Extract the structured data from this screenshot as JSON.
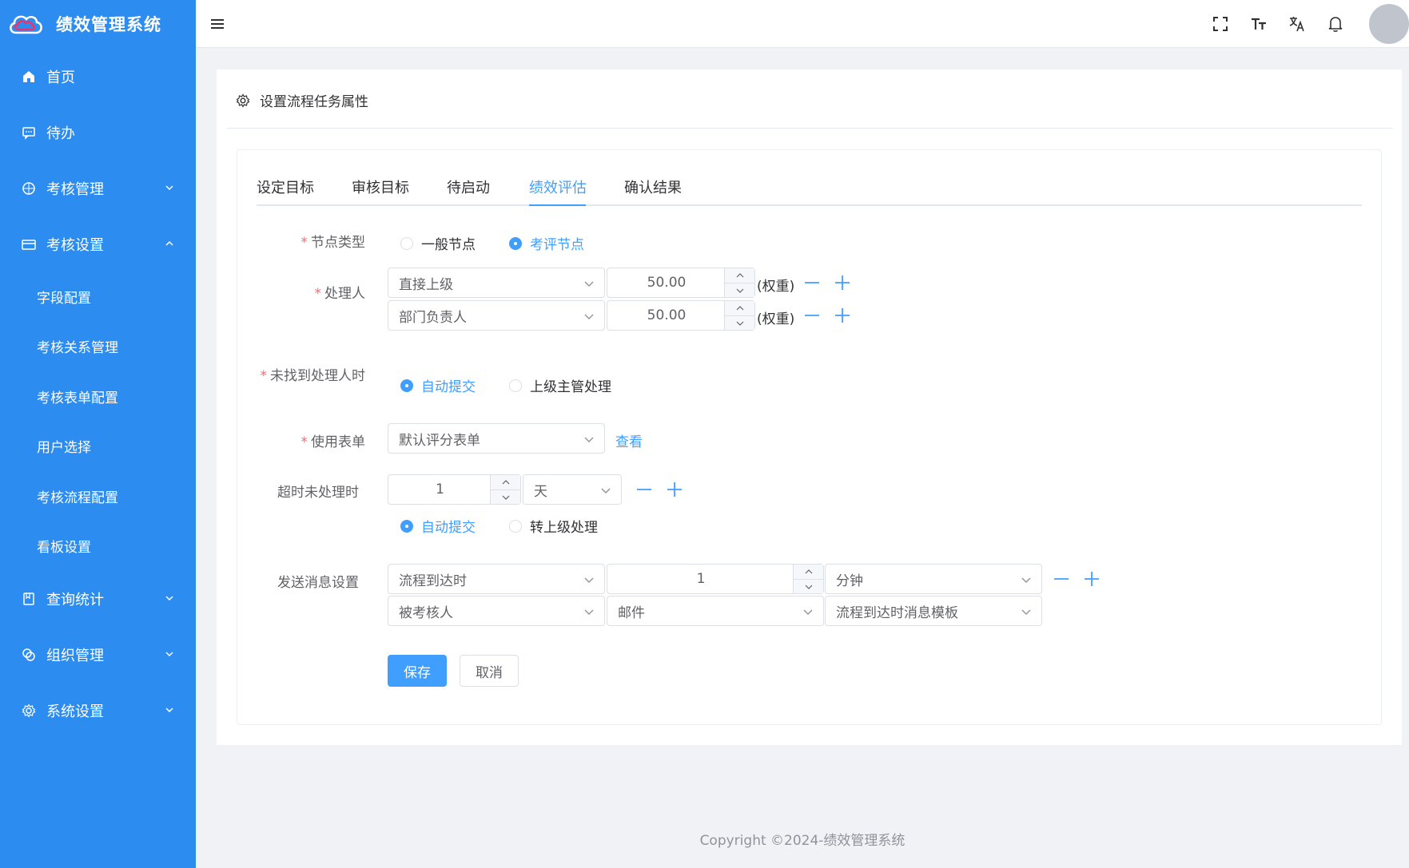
{
  "brand": {
    "title": "绩效管理系统"
  },
  "sidebar": {
    "items": [
      {
        "label": "首页",
        "icon": "home-icon"
      },
      {
        "label": "待办",
        "icon": "message-icon"
      },
      {
        "label": "考核管理",
        "icon": "compass-icon"
      },
      {
        "label": "考核设置",
        "icon": "card-icon"
      },
      {
        "label": "查询统计",
        "icon": "notebook-icon"
      },
      {
        "label": "组织管理",
        "icon": "link-icon"
      },
      {
        "label": "系统设置",
        "icon": "gear-icon"
      }
    ],
    "sub_items": [
      "字段配置",
      "考核关系管理",
      "考核表单配置",
      "用户选择",
      "考核流程配置",
      "看板设置"
    ]
  },
  "panel": {
    "title": "设置流程任务属性"
  },
  "tabs": [
    "设定目标",
    "审核目标",
    "待启动",
    "绩效评估",
    "确认结果"
  ],
  "active_tab": 3,
  "form": {
    "node_type": {
      "label": "节点类型",
      "options": [
        "一般节点",
        "考评节点"
      ],
      "selected": 1
    },
    "handler": {
      "label": "处理人",
      "weight_label": "(权重)",
      "rows": [
        {
          "select": "直接上级",
          "weight": "50.00"
        },
        {
          "select": "部门负责人",
          "weight": "50.00"
        }
      ]
    },
    "not_found": {
      "label": "未找到处理人时",
      "options": [
        "自动提交",
        "上级主管处理"
      ],
      "selected": 0
    },
    "use_form": {
      "label": "使用表单",
      "select": "默认评分表单",
      "view_link": "查看"
    },
    "timeout": {
      "label": "超时未处理时",
      "value": "1",
      "unit": "天",
      "options": [
        "自动提交",
        "转上级处理"
      ],
      "selected": 0
    },
    "message": {
      "label": "发送消息设置",
      "row1": {
        "trigger": "流程到达时",
        "value": "1",
        "unit": "分钟"
      },
      "row2": {
        "target": "被考核人",
        "channel": "邮件",
        "template": "流程到达时消息模板"
      }
    },
    "save_label": "保存",
    "cancel_label": "取消"
  },
  "footer": {
    "copyright": "Copyright ©2024-绩效管理系统"
  },
  "colors": {
    "sidebar": "#2d8cf0",
    "primary": "#409eff",
    "required": "#f56c6c"
  }
}
